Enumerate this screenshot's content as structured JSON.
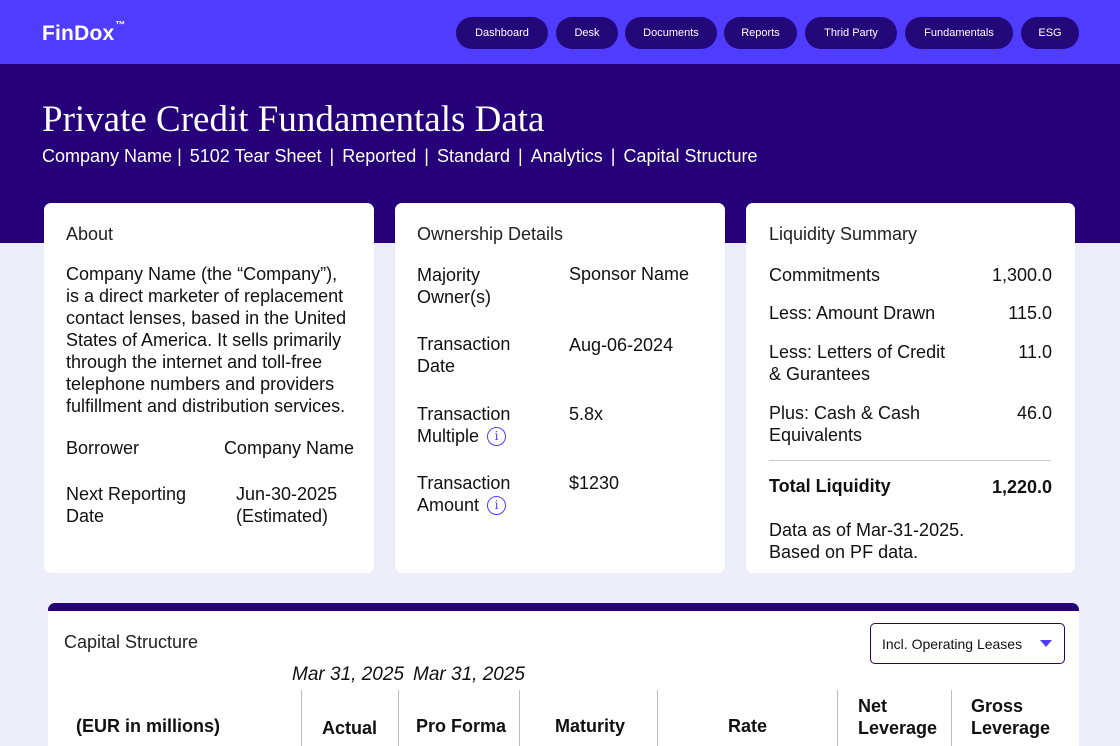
{
  "app": {
    "logo": "FinDox",
    "logo_mark": "™"
  },
  "nav": [
    "Dashboard",
    "Desk",
    "Documents",
    "Reports",
    "Thrid Party",
    "Fundamentals",
    "ESG"
  ],
  "hero": {
    "title": "Private Credit Fundamentals Data",
    "crumbs": [
      "Company Name",
      "5102 Tear Sheet",
      "Reported",
      "Standard",
      "Analytics",
      "Capital Structure"
    ]
  },
  "about": {
    "title": "About",
    "description_lines": [
      "Company Name (the “Company”),",
      "is a direct marketer of replacement",
      "contact lenses, based in the United",
      "States of America. It sells primarily",
      "through the internet and toll-free",
      "telephone numbers and providers",
      "fulfillment and distribution services."
    ],
    "borrower_label": "Borrower",
    "borrower_value": "Company Name",
    "next_reporting_label": [
      "Next Reporting",
      "Date"
    ],
    "next_reporting_value": [
      "Jun-30-2025",
      "(Estimated)"
    ]
  },
  "ownership": {
    "title": "Ownership Details",
    "rows": [
      {
        "label": [
          "Majority",
          "Owner(s)"
        ],
        "value": "Sponsor Name",
        "info": false
      },
      {
        "label": [
          "Transaction",
          "Date"
        ],
        "value": "Aug-06-2024",
        "info": false
      },
      {
        "label": [
          "Transaction",
          "Multiple"
        ],
        "value": "5.8x",
        "info": true
      },
      {
        "label": [
          "Transaction",
          "Amount"
        ],
        "value": "$1230",
        "info": true
      }
    ],
    "info_glyph": "i"
  },
  "liquidity": {
    "title": "Liquidity Summary",
    "rows": [
      {
        "label": [
          "Commitments"
        ],
        "value": "1,300.0"
      },
      {
        "label": [
          "Less: Amount Drawn"
        ],
        "value": "115.0"
      },
      {
        "label": [
          "Less: Letters of Credit",
          "& Gurantees"
        ],
        "value": "11.0"
      },
      {
        "label": [
          "Plus: Cash & Cash",
          "Equivalents"
        ],
        "value": "46.0"
      }
    ],
    "total_label": "Total Liquidity",
    "total_value": "1,220.0",
    "note": [
      "Data as of Mar-31-2025.",
      "Based on PF data."
    ]
  },
  "capital_structure": {
    "title": "Capital Structure",
    "filter_value": "Incl. Operating Leases",
    "dates": [
      "Mar 31, 2025",
      "Mar 31, 2025"
    ],
    "columns": {
      "units": "(EUR in millions)",
      "actual": "Actual",
      "pro_forma": "Pro Forma",
      "maturity": "Maturity",
      "rate": "Rate",
      "net_leverage": [
        "Net",
        "Leverage"
      ],
      "gross_leverage": [
        "Gross",
        "Leverage"
      ]
    }
  },
  "colors": {
    "topbar": "#4f3cff",
    "hero": "#250078",
    "pill": "#23087a",
    "background": "#eeeefb",
    "accent": "#4f3cff"
  }
}
